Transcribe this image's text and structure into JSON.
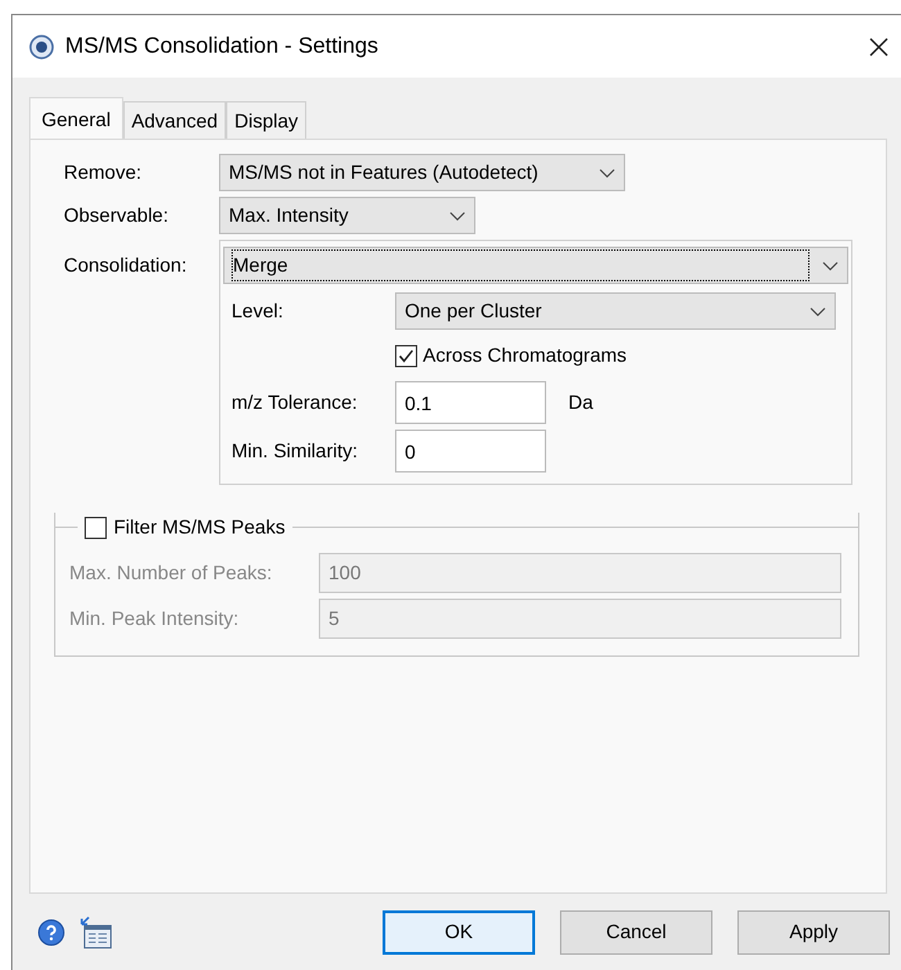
{
  "window": {
    "title": "MS/MS Consolidation - Settings"
  },
  "tabs": [
    {
      "label": "General",
      "selected": true
    },
    {
      "label": "Advanced",
      "selected": false
    },
    {
      "label": "Display",
      "selected": false
    }
  ],
  "fields": [
    {
      "label": "Remove:",
      "kind": "combo",
      "value": "MS/MS not in Features (Autodetect)"
    },
    {
      "label": "Observable:",
      "kind": "combo",
      "value": "Max. Intensity"
    }
  ],
  "consolidation": {
    "label": "Consolidation:",
    "value": "Merge",
    "focused": true,
    "fields": [
      {
        "kind": "combo",
        "label": "Level:",
        "value": "One per Cluster"
      },
      {
        "kind": "check",
        "label": "Across Chromatograms",
        "checked": true
      },
      {
        "kind": "text",
        "label": "m/z Tolerance:",
        "value": "0.1",
        "unit": "Da"
      },
      {
        "kind": "text",
        "label": "Min. Similarity:",
        "value": "0"
      }
    ]
  },
  "filter": {
    "label": "Filter MS/MS Peaks",
    "checked": false,
    "fields": [
      {
        "label": "Max. Number of Peaks:",
        "value": "100",
        "disabled": true
      },
      {
        "label": "Min. Peak Intensity:",
        "value": "5",
        "disabled": true
      }
    ]
  },
  "buttons": [
    {
      "label": "OK",
      "default": true
    },
    {
      "label": "Cancel",
      "default": false
    },
    {
      "label": "Apply",
      "default": false
    }
  ]
}
